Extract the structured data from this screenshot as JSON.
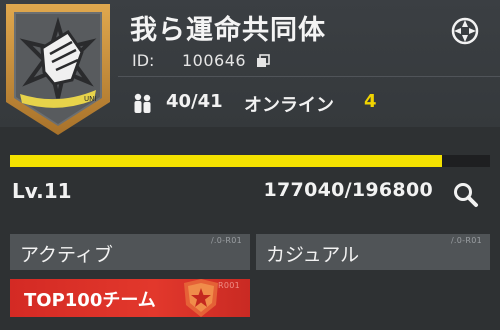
{
  "guild": {
    "name": "我ら運命共同体",
    "id_label": "ID:",
    "id_value": "100646",
    "members": "40/41",
    "online_label": "オンライン",
    "online_count": "4",
    "emblem_text": "UNI"
  },
  "level": {
    "label": "Lv.11",
    "exp": "177040/196800",
    "progress": 0.8996
  },
  "tags": {
    "active": {
      "label": "アクティブ",
      "code": "/.0-R01"
    },
    "casual": {
      "label": "カジュアル",
      "code": "/.0-R01"
    },
    "top": {
      "label": "TOP100チーム",
      "code": "R001"
    }
  },
  "icons": {
    "copy": "copy-icon",
    "settings": "crosshair-settings-icon",
    "members": "members-icon",
    "search": "search-icon",
    "badge": "star-shield-icon"
  },
  "colors": {
    "accent_yellow": "#f4e200",
    "online_yellow": "#f1d400",
    "top_red": "#d42a24",
    "emblem_gold": "#c8923c"
  }
}
